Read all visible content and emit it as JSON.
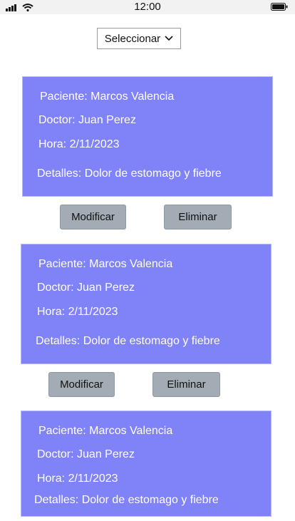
{
  "status_bar": {
    "time": "12:00"
  },
  "filter": {
    "selected": "Seleccionar",
    "icon": "chevron-down-icon"
  },
  "appointments": [
    {
      "paciente": "Paciente: Marcos Valencia",
      "doctor": "Doctor: Juan Perez",
      "hora": "Hora: 2/11/2023",
      "detalles": "Detalles: Dolor de estomago y fiebre"
    },
    {
      "paciente": "Paciente: Marcos Valencia",
      "doctor": "Doctor: Juan Perez",
      "hora": "Hora: 2/11/2023",
      "detalles": "Detalles: Dolor de estomago y fiebre"
    },
    {
      "paciente": "Paciente: Marcos Valencia",
      "doctor": "Doctor: Juan Perez",
      "hora": "Hora: 2/11/2023",
      "detalles": "Detalles: Dolor de estomago y fiebre"
    }
  ],
  "actions": {
    "modify_label": "Modificar",
    "delete_label": "Eliminar"
  },
  "colors": {
    "card_background": "#8082f7",
    "button_background": "#a3acb5"
  }
}
